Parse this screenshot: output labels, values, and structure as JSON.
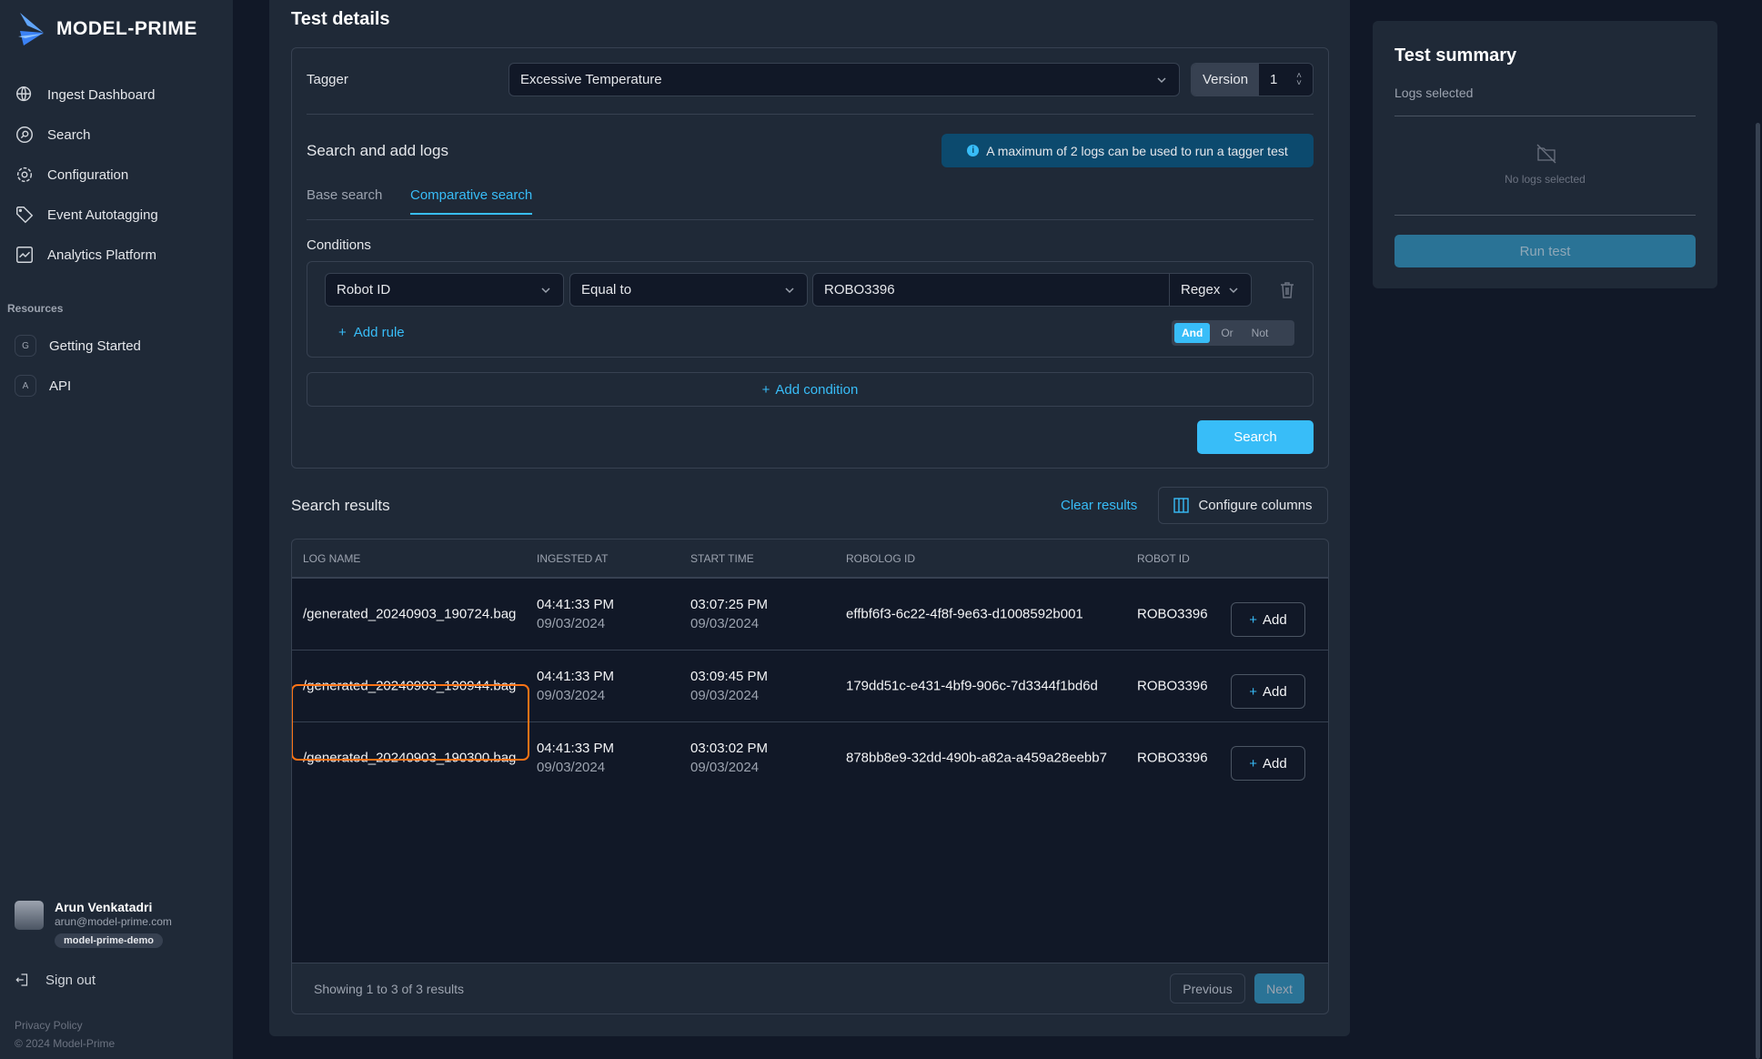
{
  "brand": {
    "name": "MODEL-PRIME"
  },
  "sidebar": {
    "items": [
      {
        "label": "Ingest Dashboard",
        "icon": "globe-download-icon"
      },
      {
        "label": "Search",
        "icon": "search-icon"
      },
      {
        "label": "Configuration",
        "icon": "gear-icon"
      },
      {
        "label": "Event Autotagging",
        "icon": "tag-icon"
      },
      {
        "label": "Analytics Platform",
        "icon": "chart-icon"
      }
    ],
    "resources_title": "Resources",
    "resources": [
      {
        "badge": "G",
        "label": "Getting Started"
      },
      {
        "badge": "A",
        "label": "API"
      }
    ],
    "user": {
      "name": "Arun Venkatadri",
      "email": "arun@model-prime.com",
      "org": "model-prime-demo"
    },
    "sign_out": "Sign out",
    "privacy": "Privacy Policy",
    "copyright": "© 2024 Model-Prime"
  },
  "main": {
    "title": "Test details",
    "tagger_label": "Tagger",
    "tagger_value": "Excessive Temperature",
    "version_label": "Version",
    "version_value": "1",
    "search_title": "Search and add logs",
    "info": "A maximum of 2 logs can be used to run a tagger test",
    "tabs": [
      {
        "label": "Base search"
      },
      {
        "label": "Comparative search",
        "active": true
      }
    ],
    "conditions_label": "Conditions",
    "condition": {
      "field": "Robot ID",
      "operator": "Equal to",
      "value": "ROBO3396",
      "mode": "Regex"
    },
    "add_rule": "Add rule",
    "logic": [
      "And",
      "Or",
      "Not"
    ],
    "logic_active": "And",
    "add_condition": "Add condition",
    "search_button": "Search",
    "results_title": "Search results",
    "clear_results": "Clear results",
    "configure_columns": "Configure columns",
    "columns": [
      "LOG NAME",
      "INGESTED AT",
      "START TIME",
      "ROBOLOG ID",
      "ROBOT ID"
    ],
    "rows": [
      {
        "log": "/generated_20240903_190724.bag",
        "ing_t": "04:41:33 PM",
        "ing_d": "09/03/2024",
        "st_t": "03:07:25 PM",
        "st_d": "09/03/2024",
        "id": "effbf6f3-6c22-4f8f-9e63-d1008592b001",
        "robot": "ROBO3396",
        "add": "Add"
      },
      {
        "log": "/generated_20240903_190944.bag",
        "ing_t": "04:41:33 PM",
        "ing_d": "09/03/2024",
        "st_t": "03:09:45 PM",
        "st_d": "09/03/2024",
        "id": "179dd51c-e431-4bf9-906c-7d3344f1bd6d",
        "robot": "ROBO3396",
        "add": "Add"
      },
      {
        "log": "/generated_20240903_190300.bag",
        "ing_t": "04:41:33 PM",
        "ing_d": "09/03/2024",
        "st_t": "03:03:02 PM",
        "st_d": "09/03/2024",
        "id": "878bb8e9-32dd-490b-a82a-a459a28eebb7",
        "robot": "ROBO3396",
        "add": "Add"
      }
    ],
    "showing": "Showing 1 to 3 of 3 results",
    "previous": "Previous",
    "next": "Next"
  },
  "summary": {
    "title": "Test summary",
    "logs_selected": "Logs selected",
    "empty": "No logs selected",
    "run": "Run test"
  },
  "colors": {
    "accent": "#38bdf8",
    "highlight": "#f97316",
    "info_bg": "#0c4a6e",
    "run_bg": "#2a7396"
  }
}
